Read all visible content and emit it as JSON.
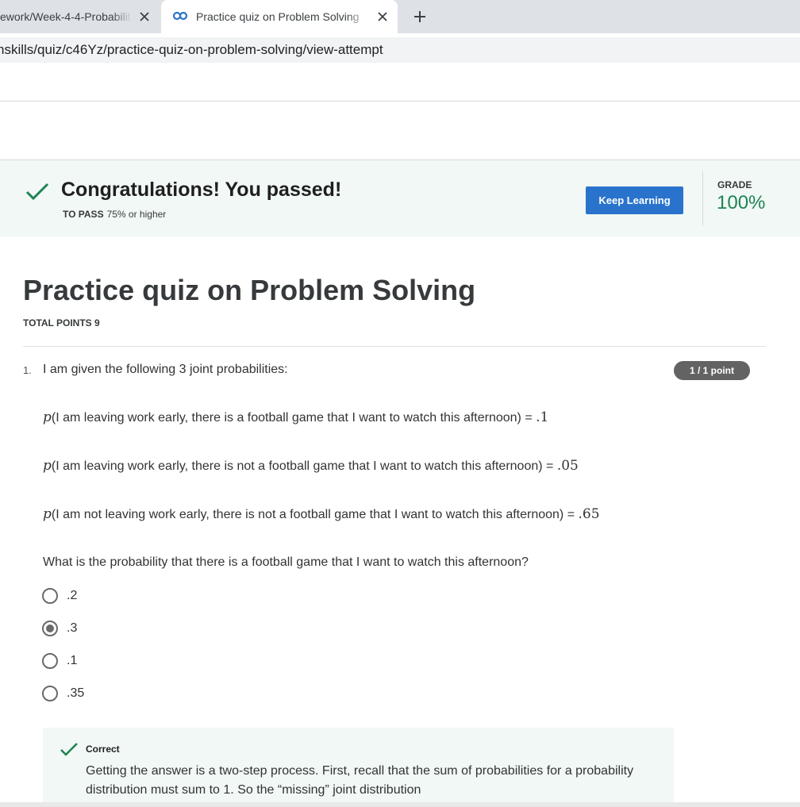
{
  "browser": {
    "tabs": [
      {
        "title": "ework/Week-4-4-Probabilit",
        "active": false,
        "icon": "document-icon"
      },
      {
        "title": "Practice quiz on Problem Solving",
        "active": true,
        "icon": "coursera-infinity-icon"
      }
    ],
    "close_glyph": "✕",
    "new_tab_glyph": "+",
    "url": "nskills/quiz/c46Yz/practice-quiz-on-problem-solving/view-attempt"
  },
  "banner": {
    "title": "Congratulations! You passed!",
    "to_pass_label": "TO PASS",
    "to_pass_value": "75% or higher",
    "button_label": "Keep Learning",
    "grade_label": "GRADE",
    "grade_value": "100%",
    "accent_color": "#1f8354",
    "button_color": "#2a73cc"
  },
  "quiz": {
    "title": "Practice quiz on Problem Solving",
    "total_points": "TOTAL POINTS 9",
    "question": {
      "number": "1.",
      "intro": "I am given the following 3 joint probabilities:",
      "points": "1 / 1 point",
      "probabilities": [
        {
          "p": "p",
          "text": "(I am leaving work early, there is a football game that I want to watch this afternoon) = ",
          "value": ".1"
        },
        {
          "p": "p",
          "text": "(I am leaving work early, there is not a football game that I want to watch this afternoon) = ",
          "value": ".05"
        },
        {
          "p": "p",
          "text": "(I am not leaving work early, there is not a football game that I want to watch this afternoon) = ",
          "value": ".65"
        }
      ],
      "prompt": "What is the probability that there is a football game that I want to watch this afternoon?",
      "options": [
        {
          "label": ".2",
          "selected": false
        },
        {
          "label": ".3",
          "selected": true
        },
        {
          "label": ".1",
          "selected": false
        },
        {
          "label": ".35",
          "selected": false
        }
      ],
      "feedback": {
        "title": "Correct",
        "body": "Getting the answer is a two-step process. First, recall that the sum of probabilities for a probability distribution must sum to 1. So the “missing” joint distribution"
      }
    }
  }
}
